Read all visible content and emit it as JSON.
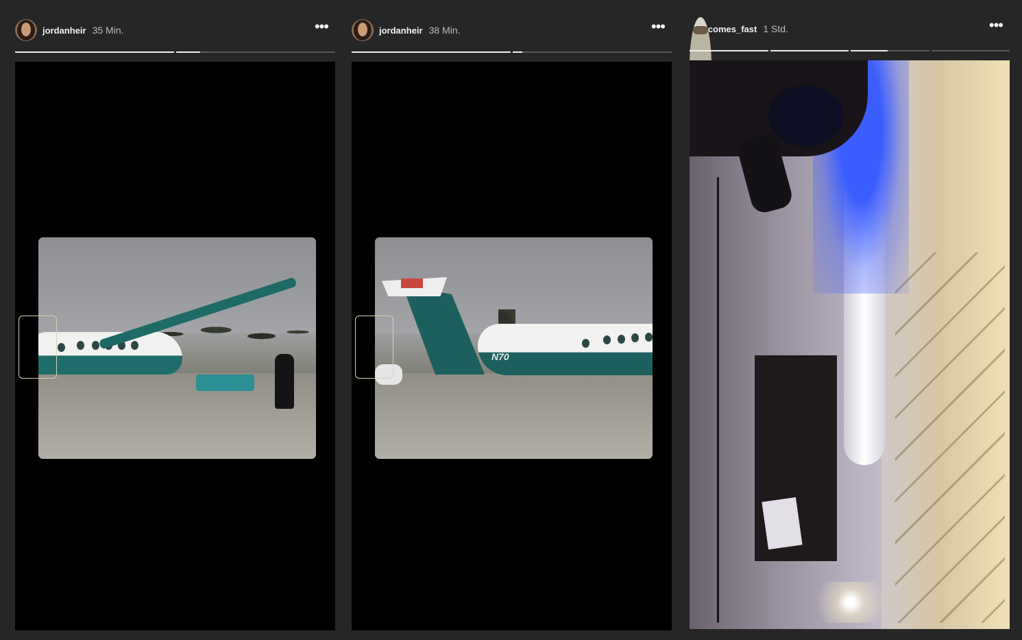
{
  "stories": [
    {
      "username": "jordanheir",
      "time": "35 Min.",
      "progress": [
        1.0,
        0.15
      ],
      "media": {
        "type": "video",
        "registration": ""
      }
    },
    {
      "username": "jordanheir",
      "time": "38 Min.",
      "progress": [
        1.0,
        0.06
      ],
      "media": {
        "type": "video",
        "registration": "N70"
      }
    },
    {
      "username": "lifecomes_fast",
      "time": "1 Std.",
      "progress": [
        1.0,
        1.0,
        0.47,
        0.0
      ],
      "media": {
        "type": "image"
      }
    }
  ],
  "icons": {
    "more": "more-options-icon"
  },
  "colors": {
    "background": "#262626",
    "progress_active": "#f0f0f0",
    "progress_inactive": "#5a5a5a"
  }
}
